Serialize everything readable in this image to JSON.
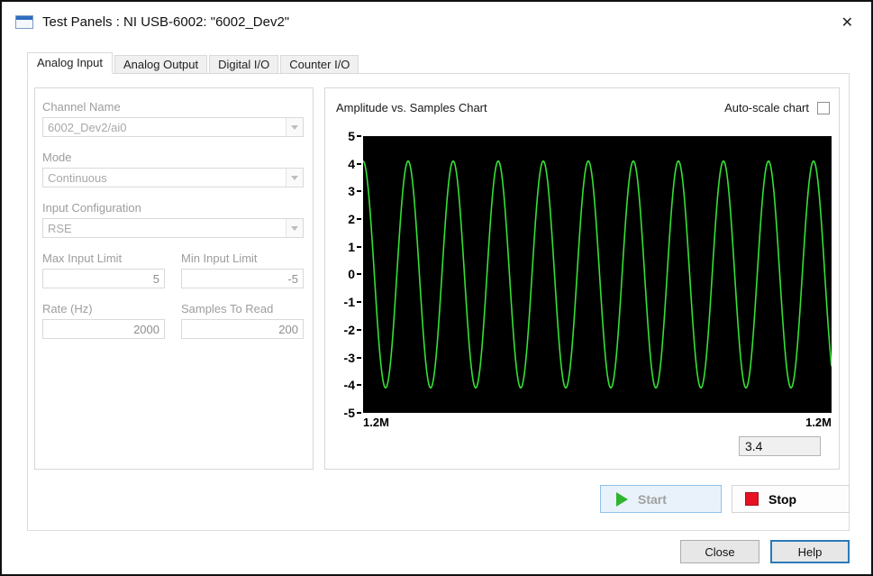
{
  "window": {
    "title": "Test Panels : NI USB-6002: \"6002_Dev2\"",
    "close_glyph": "✕"
  },
  "tabs": [
    {
      "label": "Analog Input",
      "active": true
    },
    {
      "label": "Analog Output",
      "active": false
    },
    {
      "label": "Digital I/O",
      "active": false
    },
    {
      "label": "Counter I/O",
      "active": false
    }
  ],
  "config": {
    "channel_name": {
      "label": "Channel Name",
      "value": "6002_Dev2/ai0"
    },
    "mode": {
      "label": "Mode",
      "value": "Continuous"
    },
    "input_configuration": {
      "label": "Input Configuration",
      "value": "RSE"
    },
    "max_input_limit": {
      "label": "Max Input Limit",
      "value": "5"
    },
    "min_input_limit": {
      "label": "Min Input Limit",
      "value": "-5"
    },
    "rate": {
      "label": "Rate (Hz)",
      "value": "2000"
    },
    "samples_to_read": {
      "label": "Samples To Read",
      "value": "200"
    }
  },
  "chart": {
    "title": "Amplitude vs. Samples Chart",
    "autoscale_label": "Auto-scale chart",
    "autoscale_checked": false,
    "y_ticks": [
      "5",
      "4",
      "3",
      "2",
      "1",
      "0",
      "-1",
      "-2",
      "-3",
      "-4",
      "-5"
    ],
    "x_label_left": "1.2M",
    "x_label_right": "1.2M",
    "last_value": "3.4",
    "wave_color": "#35e035",
    "plot_background": "#000000"
  },
  "chart_data": {
    "type": "line",
    "title": "Amplitude vs. Samples Chart",
    "ylim": [
      -5,
      5
    ],
    "y_tick_step": 1,
    "x_start_label": "1.2M",
    "x_end_label": "1.2M",
    "waveform": "sine",
    "amplitude": 4.1,
    "cycles": 10.4,
    "phase": 0,
    "last_sample_value": 3.4,
    "grid": false,
    "legend": false
  },
  "controls": {
    "start_label": "Start",
    "stop_label": "Stop",
    "close_label": "Close",
    "help_label": "Help"
  }
}
